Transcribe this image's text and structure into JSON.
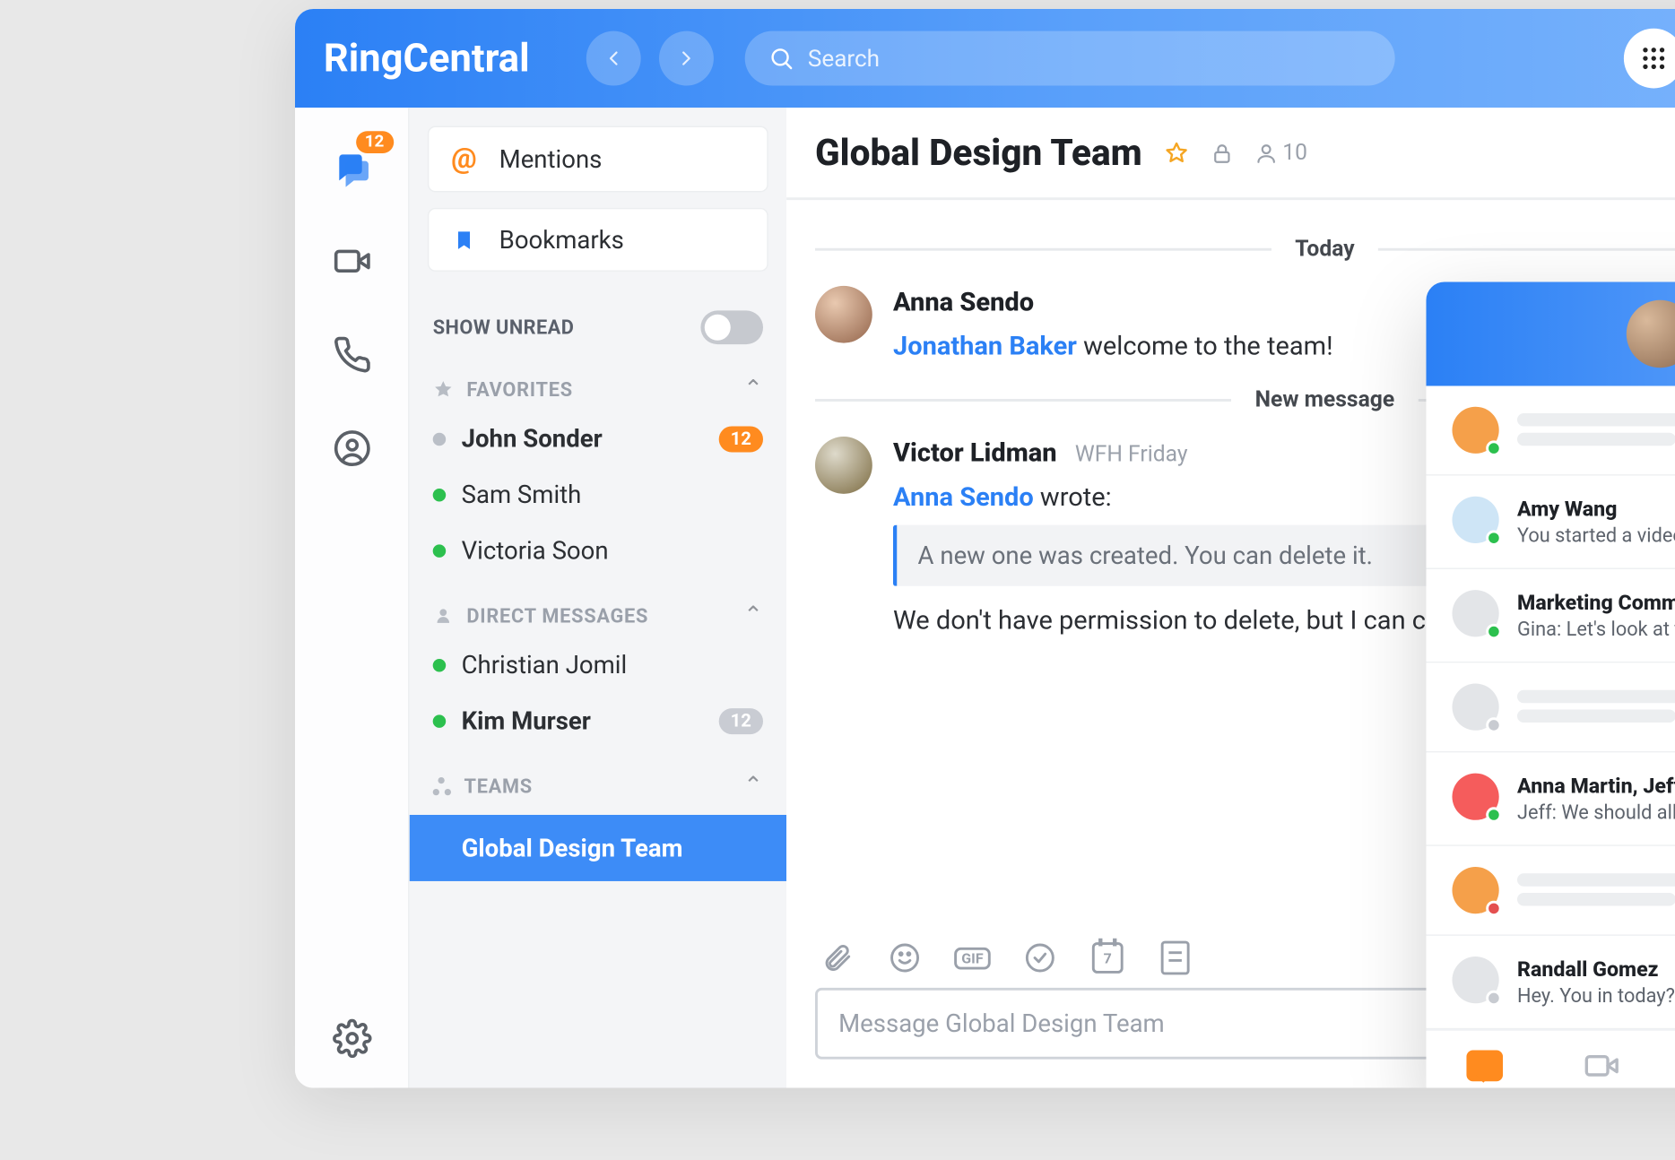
{
  "header": {
    "brand": "RingCentral",
    "search_placeholder": "Search"
  },
  "rail": {
    "chat_badge": "12"
  },
  "sidebar": {
    "mentions_label": "Mentions",
    "bookmarks_label": "Bookmarks",
    "show_unread_label": "SHOW UNREAD",
    "sections": {
      "favorites": {
        "title": "FAVORITES",
        "items": [
          {
            "name": "John Sonder",
            "bold": true,
            "presence": "gray",
            "badge": "12",
            "badge_style": "orange"
          },
          {
            "name": "Sam Smith",
            "bold": false,
            "presence": "green"
          },
          {
            "name": "Victoria Soon",
            "bold": false,
            "presence": "green"
          }
        ]
      },
      "dms": {
        "title": "DIRECT MESSAGES",
        "items": [
          {
            "name": "Christian Jomil",
            "bold": false,
            "presence": "green"
          },
          {
            "name": "Kim Murser",
            "bold": true,
            "presence": "green",
            "badge": "12",
            "badge_style": "gray"
          }
        ]
      },
      "teams": {
        "title": "TEAMS",
        "items": [
          {
            "name": "Global Design Team",
            "active": true
          }
        ]
      }
    }
  },
  "chat": {
    "title": "Global Design Team",
    "member_count": "10",
    "dividers": {
      "today": "Today",
      "new_message": "New message"
    },
    "messages": [
      {
        "author": "Anna Sendo",
        "mention": "Jonathan Baker",
        "after_mention": " welcome to the team!"
      },
      {
        "author": "Victor Lidman",
        "subtitle": "WFH Friday",
        "reply_to": "Anna Sendo",
        "reply_suffix": " wrote:",
        "quote": "A new one was created. You can delete it.",
        "body": "We don't have permission to delete, but I can close it"
      }
    ],
    "composer": {
      "calendar_badge": "7",
      "placeholder": "Message Global Design Team"
    }
  },
  "mini": {
    "rows": [
      {
        "type": "skeleton",
        "avatar_color": "c-orange",
        "presence": "p-green"
      },
      {
        "type": "text",
        "avatar_color": "c-paleblue",
        "presence": "p-green",
        "name": "Amy Wang",
        "sub": "You started a video call"
      },
      {
        "type": "text",
        "avatar_color": "c-lightgray",
        "presence": "p-green",
        "name": "Marketing Comms",
        "sub": "Gina: Let's look at the report"
      },
      {
        "type": "skeleton",
        "avatar_color": "c-lightgray",
        "presence": "p-gray"
      },
      {
        "type": "text",
        "avatar_color": "c-red",
        "presence": "p-green",
        "name": "Anna Martin, Jeff Middleton",
        "sub": "Jeff: We should all meet later"
      },
      {
        "type": "skeleton",
        "avatar_color": "c-orange",
        "presence": "p-red"
      },
      {
        "type": "text",
        "avatar_color": "c-lightgray",
        "presence": "p-gray",
        "name": "Randall Gomez",
        "sub": "Hey. You in today?"
      }
    ]
  }
}
